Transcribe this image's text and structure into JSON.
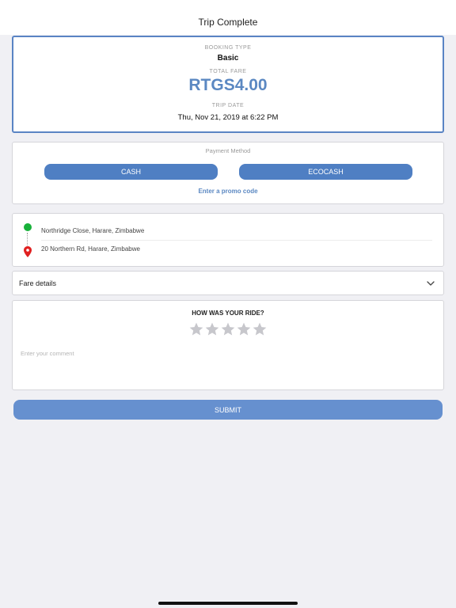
{
  "nav": {
    "title": "Trip Complete"
  },
  "summary": {
    "booking_type_label": "BOOKING TYPE",
    "booking_type": "Basic",
    "total_fare_label": "TOTAL FARE",
    "total_fare": "RTGS4.00",
    "trip_date_label": "TRIP DATE",
    "trip_date": "Thu, Nov 21, 2019 at 6:22 PM"
  },
  "payment": {
    "label": "Payment Method",
    "cash": "CASH",
    "ecocash": "ECOCASH",
    "promo": "Enter a promo code"
  },
  "route": {
    "pickup": "Northridge Close, Harare, Zimbabwe",
    "dropoff": "20 Northern Rd, Harare, Zimbabwe"
  },
  "fare_details": {
    "label": "Fare details"
  },
  "rating": {
    "question": "HOW WAS YOUR RIDE?",
    "stars_selected": 0,
    "stars_total": 5,
    "comment_placeholder": "Enter your comment"
  },
  "submit": {
    "label": "SUBMIT"
  },
  "colors": {
    "accent": "#4f7fc3",
    "fare_text": "#5b88c2",
    "pickup_dot": "#18b13a",
    "dropoff_pin": "#e02020",
    "star_empty": "#c7c7cc"
  }
}
